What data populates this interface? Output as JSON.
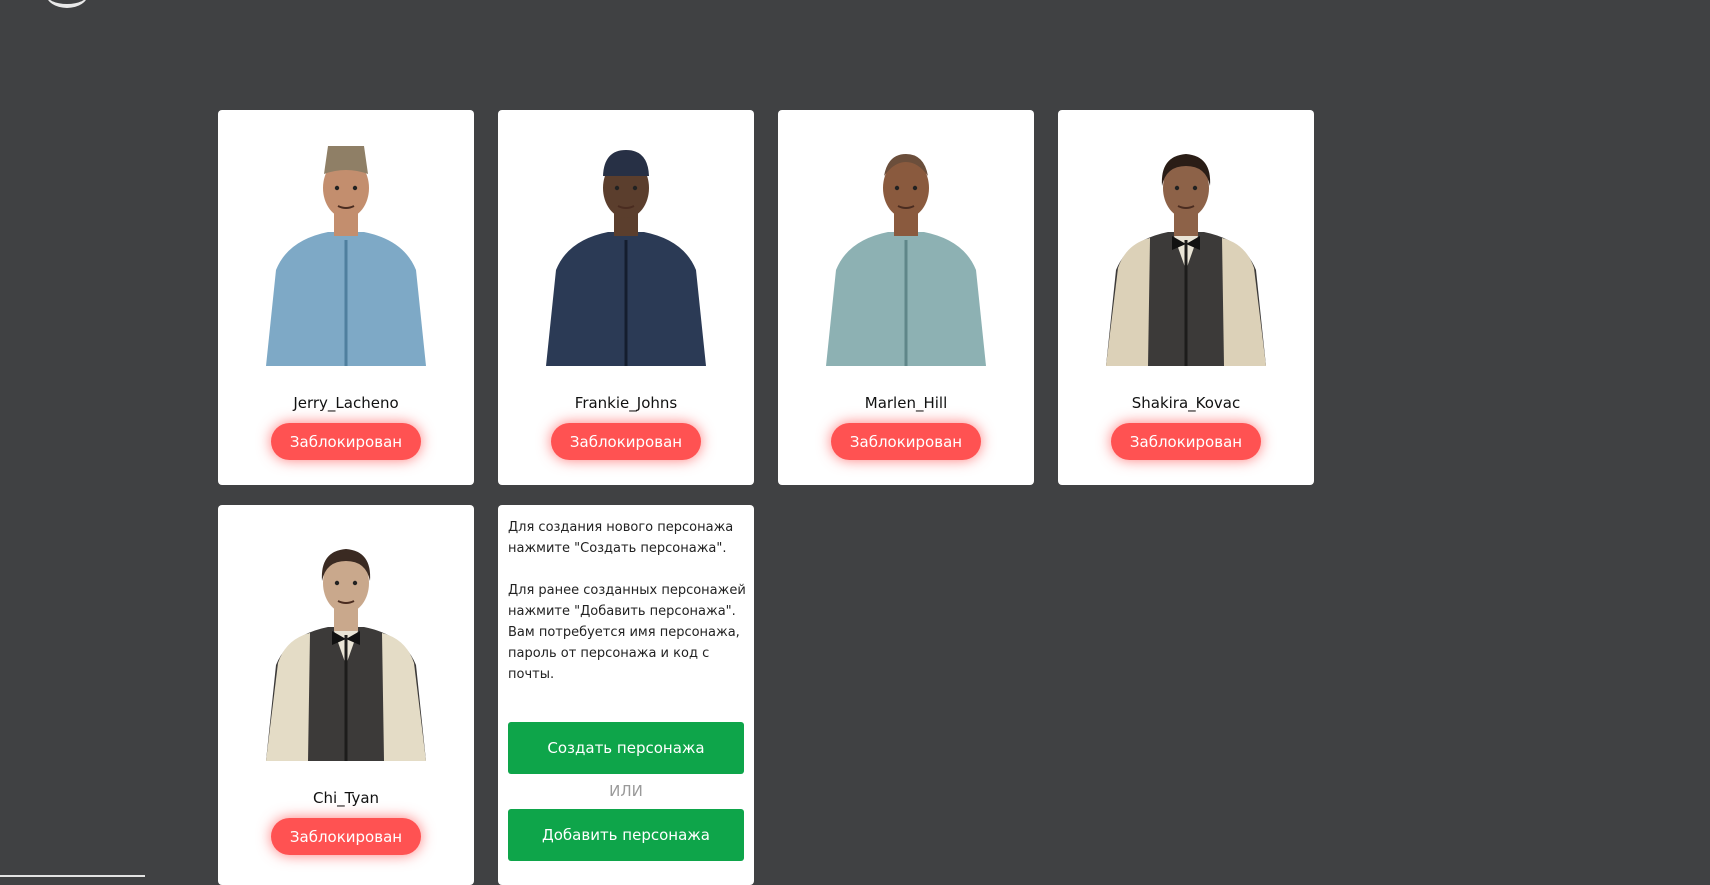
{
  "characters": [
    {
      "name": "Jerry_Lacheno",
      "status_label": "Заблокирован",
      "skin": {
        "hat": "#8f7f66",
        "hat_style": "kufi",
        "skin": "#c38e6e",
        "shirt": "#7ea9c6",
        "shirt_dark": "#4f7f9e",
        "hair": "#5a4231"
      }
    },
    {
      "name": "Frankie_Johns",
      "status_label": "Заблокирован",
      "skin": {
        "hat": "#273045",
        "hat_style": "cap",
        "skin": "#5b3e2d",
        "shirt": "#2b3a55",
        "shirt_dark": "#141d2e",
        "hair": "#1e1e1e"
      }
    },
    {
      "name": "Marlen_Hill",
      "status_label": "Заблокирован",
      "skin": {
        "hat": "",
        "hat_style": "none",
        "skin": "#8a5a3e",
        "shirt": "#8db1b3",
        "shirt_dark": "#5f8689",
        "hair": "#6b4e3b"
      }
    },
    {
      "name": "Shakira_Kovac",
      "status_label": "Заблокирован",
      "skin": {
        "hat": "",
        "hat_style": "hair",
        "skin": "#8d6248",
        "shirt": "#3c3a39",
        "shirt_dark": "#1d1c1b",
        "hair": "#2a1d16",
        "sleeves": "#dcd1b8"
      }
    },
    {
      "name": "Chi_Tyan",
      "status_label": "Заблокирован",
      "skin": {
        "hat": "",
        "hat_style": "hair",
        "skin": "#c9a88c",
        "shirt": "#3c3a39",
        "shirt_dark": "#1d1c1b",
        "hair": "#3a2a22",
        "sleeves": "#e4dcc6"
      }
    }
  ],
  "info": {
    "paragraph1": "Для создания нового персонажа нажмите \"Создать персонажа\".",
    "paragraph2": "Для ранее созданных персонажей нажмите \"Добавить персонажа\". Вам потребуется имя персонажа, пароль от персонажа и код с почты.",
    "create_label": "Создать персонажа",
    "or_label": "ИЛИ",
    "add_label": "Добавить персонажа"
  },
  "colors": {
    "background": "#404143",
    "card": "#ffffff",
    "banned": "#ff5252",
    "action": "#0ea54a"
  }
}
